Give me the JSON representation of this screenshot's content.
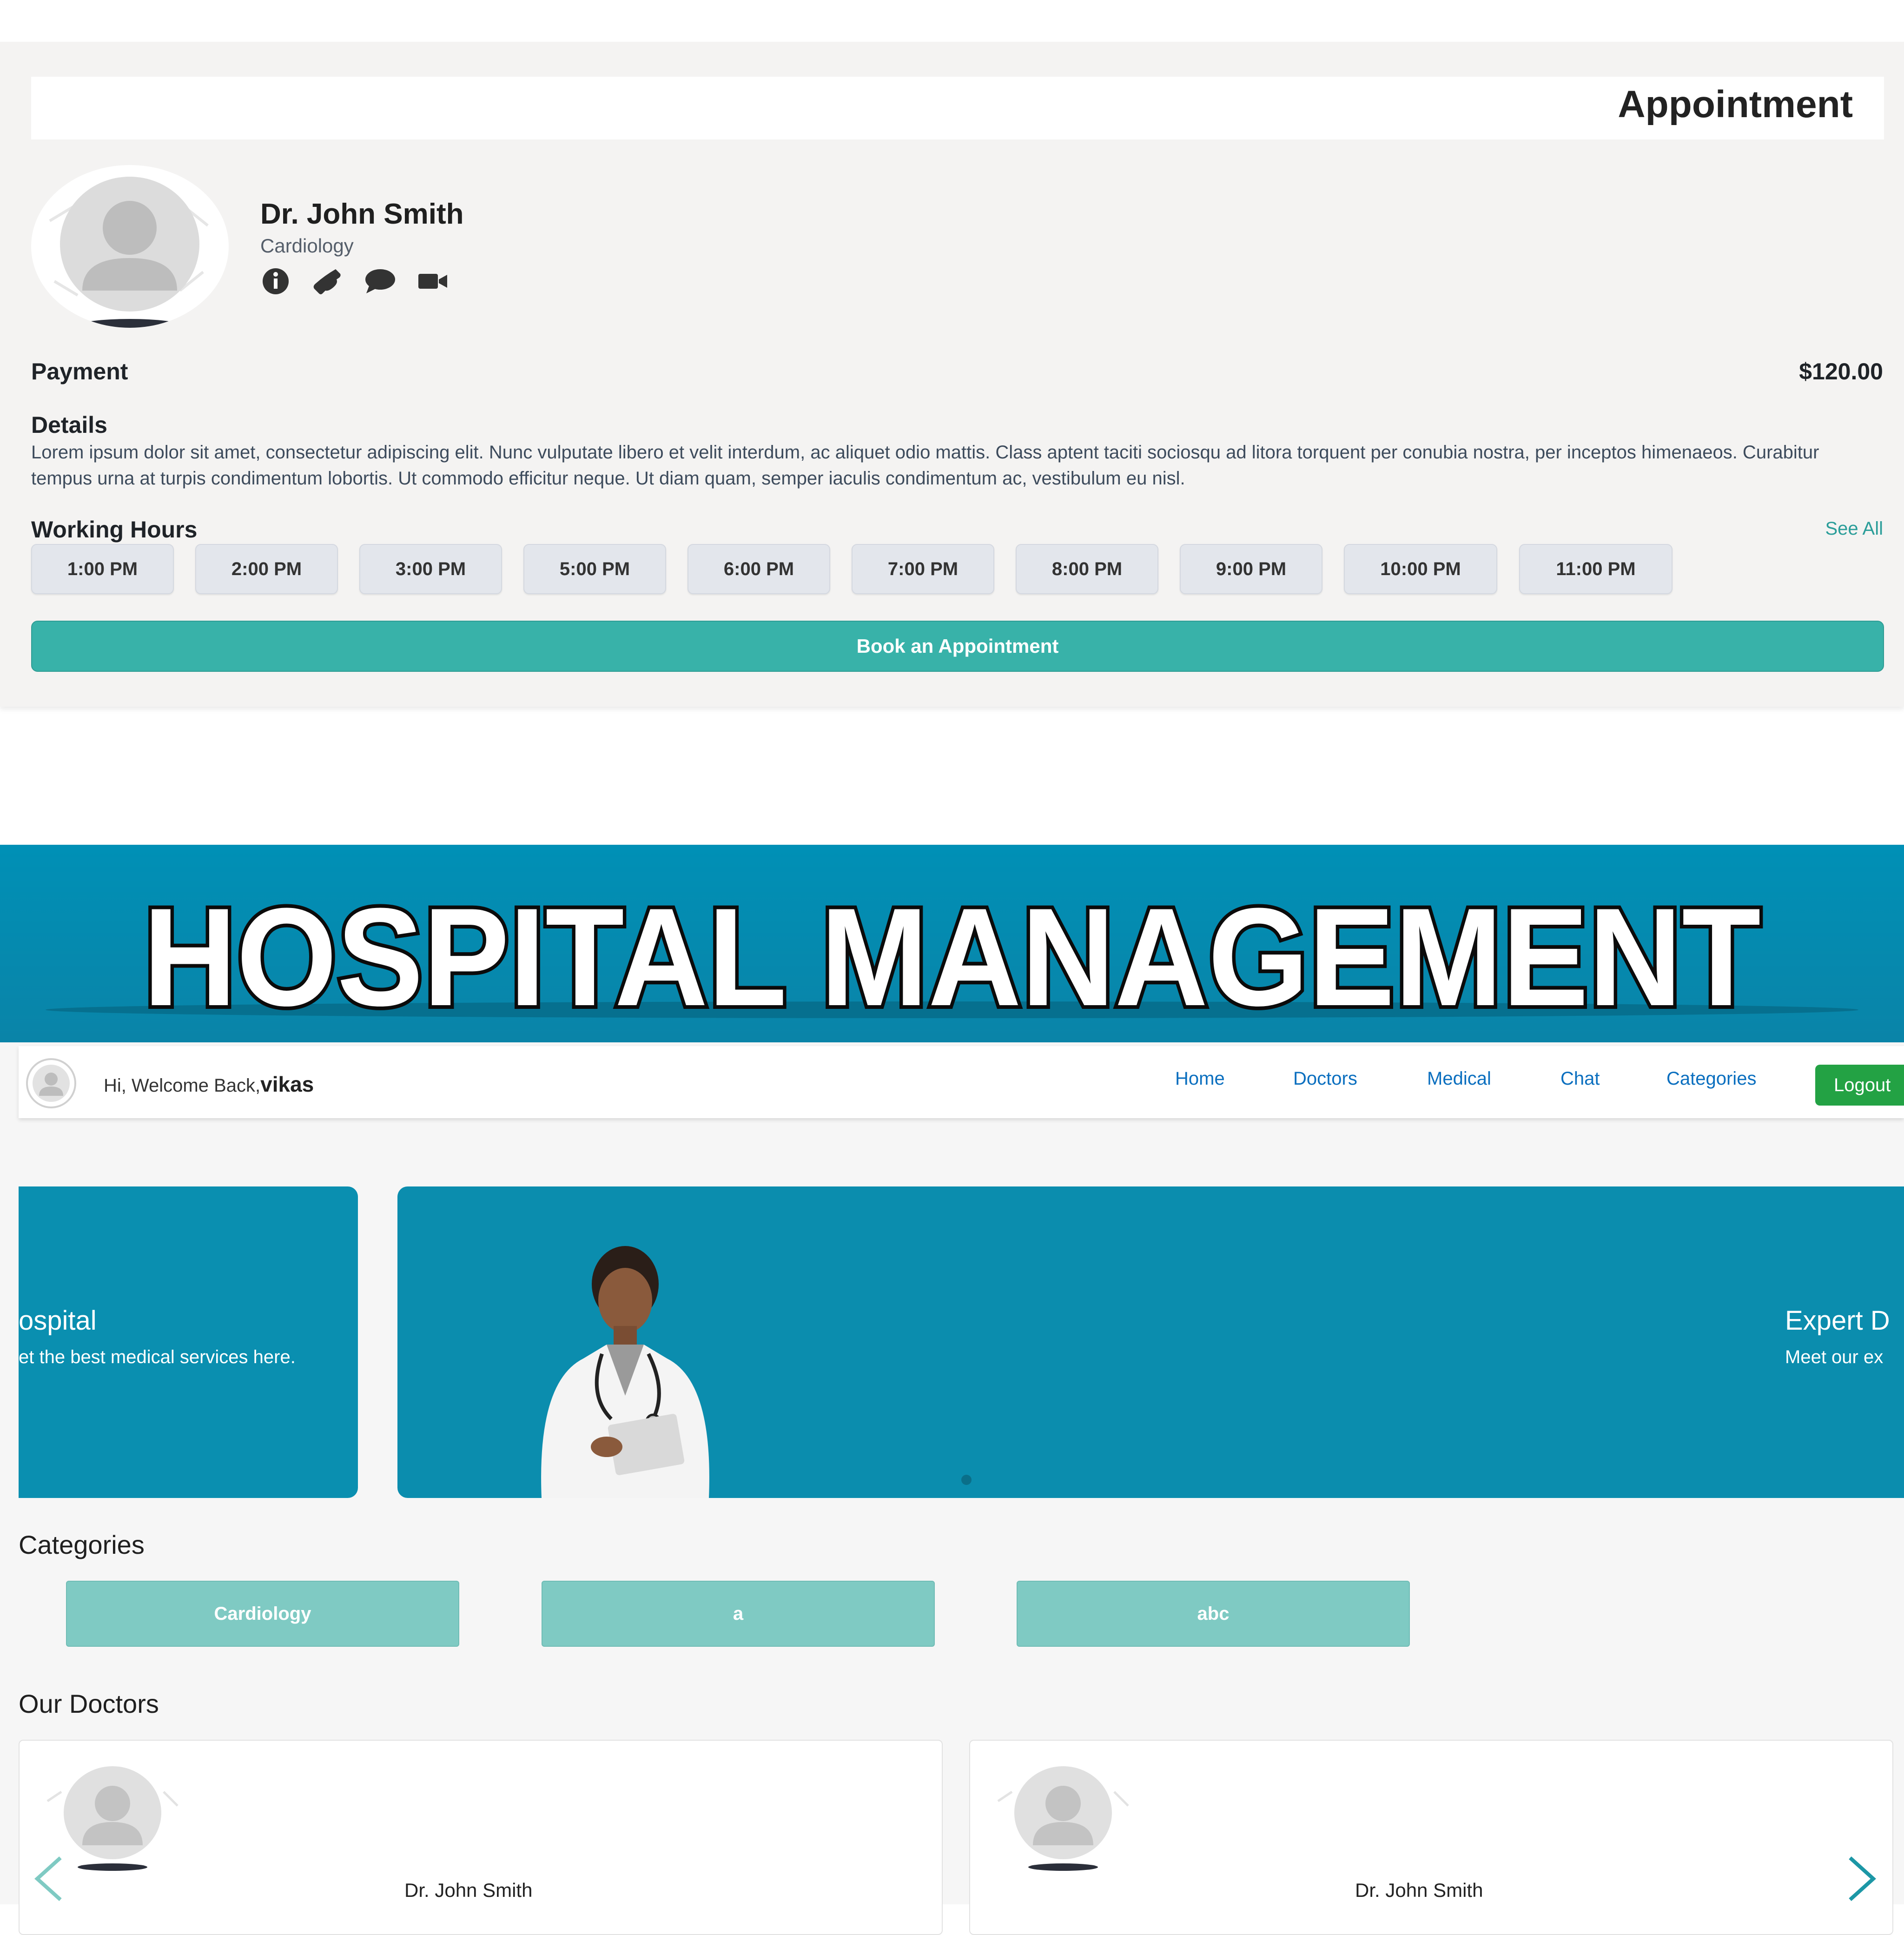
{
  "appointment": {
    "title": "Appointment",
    "doctor": {
      "name": "Dr. John Smith",
      "specialty": "Cardiology"
    },
    "actions": [
      {
        "icon": "info-icon"
      },
      {
        "icon": "phone-icon"
      },
      {
        "icon": "chat-icon"
      },
      {
        "icon": "video-icon"
      }
    ],
    "payment_label": "Payment",
    "payment_amount": "$120.00",
    "details_label": "Details",
    "details_text": "Lorem ipsum dolor sit amet, consectetur adipiscing elit. Nunc vulputate libero et velit interdum, ac aliquet odio mattis. Class aptent taciti sociosqu ad litora torquent per conubia nostra, per inceptos himenaeos. Curabitur tempus urna at turpis condimentum lobortis. Ut commodo efficitur neque. Ut diam quam, semper iaculis condimentum ac, vestibulum eu nisl.",
    "working_hours_label": "Working Hours",
    "see_all": "See All",
    "slots": [
      "1:00 PM",
      "2:00 PM",
      "3:00 PM",
      "5:00 PM",
      "6:00 PM",
      "7:00 PM",
      "8:00 PM",
      "9:00 PM",
      "10:00 PM",
      "11:00 PM"
    ],
    "book_button": "Book an Appointment"
  },
  "banner": {
    "title": "HOSPITAL MANAGEMENT"
  },
  "navbar": {
    "greeting": "Hi, Welcome Back,",
    "username": "vikas",
    "links": [
      "Home",
      "Doctors",
      "Medical",
      "Chat",
      "Categories"
    ],
    "logout": "Logout"
  },
  "slides": [
    {
      "title": "ospital",
      "subtitle": "et the best medical services here."
    },
    {
      "title": "Expert D",
      "subtitle": "Meet our ex"
    }
  ],
  "categories": {
    "heading": "Categories",
    "items": [
      "Cardiology",
      "a",
      "abc"
    ]
  },
  "doctors": {
    "heading": "Our Doctors",
    "cards": [
      {
        "name": "Dr. John Smith"
      },
      {
        "name": "Dr. John Smith"
      }
    ]
  },
  "colors": {
    "teal_button": "#38b2a9",
    "banner_blue": "#0090b6",
    "nav_link": "#0b6fbf",
    "logout_green": "#23a244",
    "category_teal": "#7fcac3"
  }
}
